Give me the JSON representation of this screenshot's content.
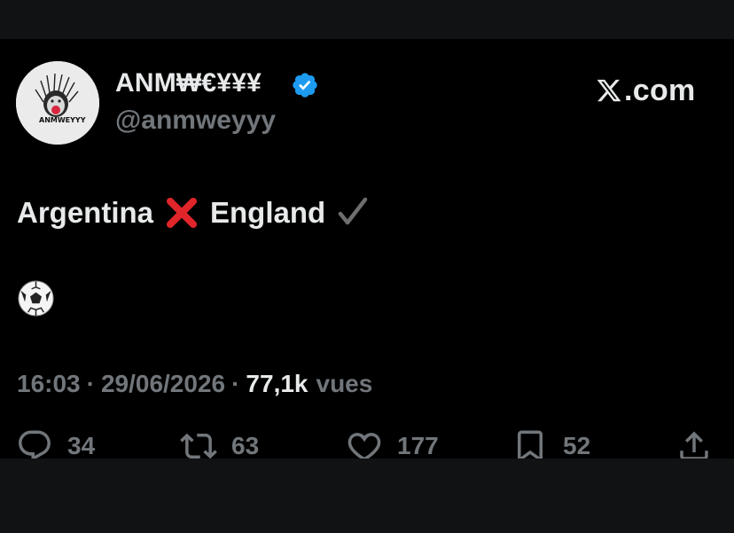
{
  "author": {
    "display_name": "ANM₩€¥¥¥",
    "handle": "@anmweyyy",
    "verified": true,
    "avatar_text": "ANMWEYYY"
  },
  "brand": {
    "domain": ".com"
  },
  "tweet": {
    "word1": "Argentina",
    "word2": "England",
    "emoji_cross": "cross-mark-icon",
    "emoji_check": "check-mark-icon",
    "emoji_ball": "soccer-ball-icon"
  },
  "meta": {
    "time": "16:03",
    "separator": "·",
    "date": "29/06/2026",
    "views_count": "77,1k",
    "views_label": "vues"
  },
  "actions": {
    "replies": "34",
    "reposts": "63",
    "likes": "177",
    "bookmarks": "52"
  },
  "colors": {
    "background": "#000000",
    "text_primary": "#e7e9ea",
    "text_secondary": "#71767b",
    "verified_blue": "#1d9bf0",
    "cross_red": "#e0252b"
  }
}
